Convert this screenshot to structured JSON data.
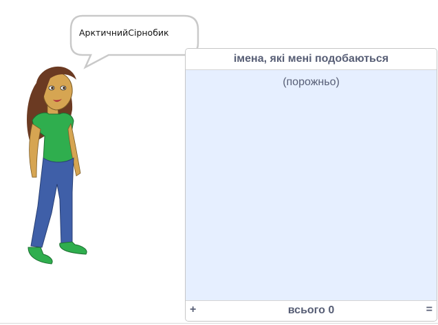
{
  "sprite": {
    "speech_bubble": "АрктичнийСірнобик"
  },
  "list_monitor": {
    "title": "імена, які мені подобаються",
    "empty_label": "(порожньо)",
    "add_label": "+",
    "count_label": "всього 0",
    "resize_label": "="
  }
}
